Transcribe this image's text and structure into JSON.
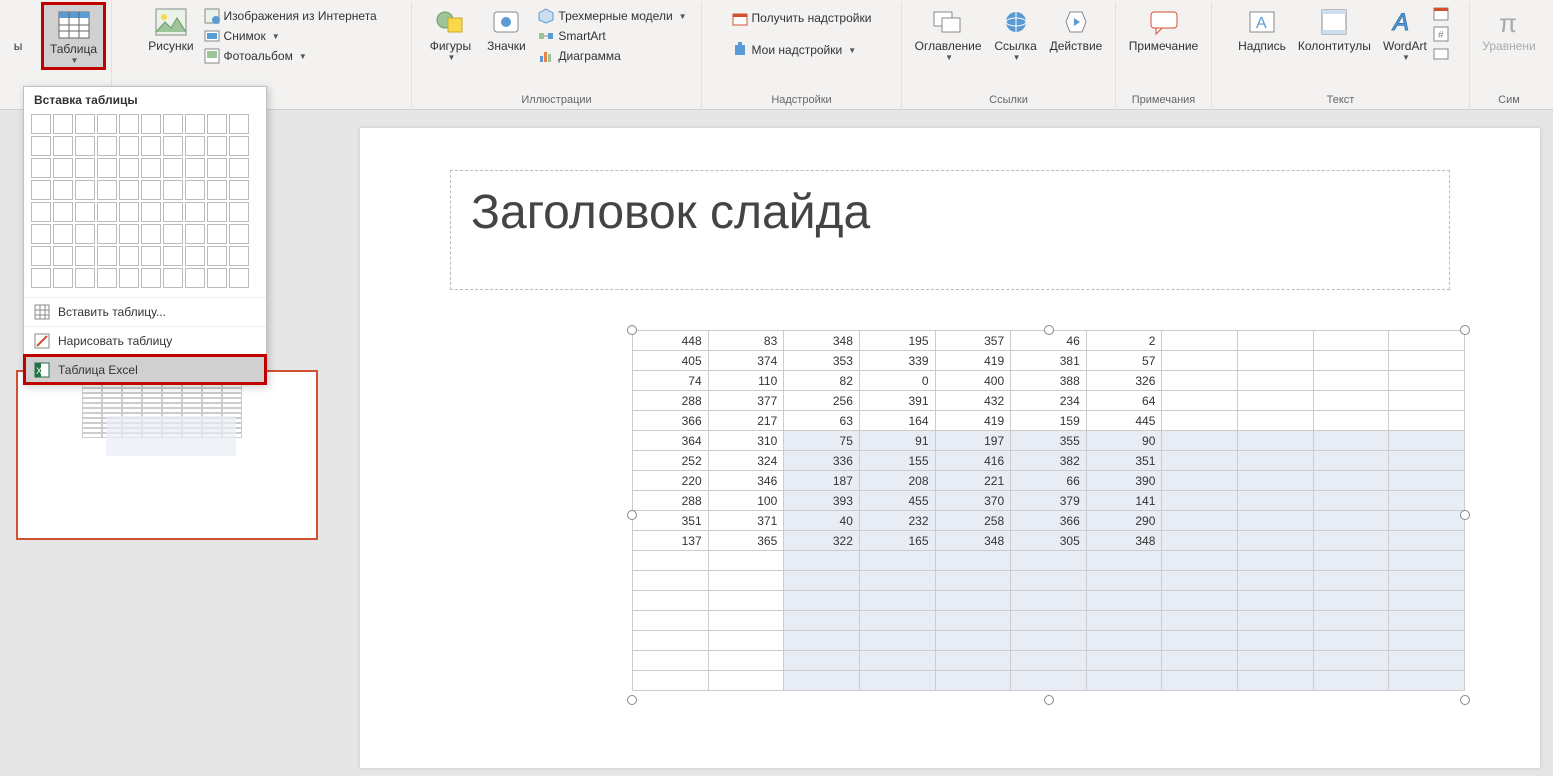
{
  "ribbon": {
    "table_btn": "Таблица",
    "pictures_btn": "Рисунки",
    "online_pics": "Изображения из Интернета",
    "screenshot": "Снимок",
    "photo_album": "Фотоальбом",
    "shapes": "Фигуры",
    "icons": "Значки",
    "models3d": "Трехмерные модели",
    "smartart": "SmartArt",
    "chart": "Диаграмма",
    "get_addins": "Получить надстройки",
    "my_addins": "Мои надстройки",
    "zoom": "Оглавление",
    "link": "Ссылка",
    "action": "Действие",
    "comment": "Примечание",
    "textbox": "Надпись",
    "header_footer": "Колонтитулы",
    "wordart": "WordArt",
    "equation": "Уравнени",
    "group_illustrations": "Иллюстрации",
    "group_addins": "Надстройки",
    "group_links": "Ссылки",
    "group_comments": "Примечания",
    "group_text": "Текст",
    "group_symbols": "Сим",
    "leftcut": "ы"
  },
  "table_dropdown": {
    "header": "Вставка таблицы",
    "insert_table": "Вставить таблицу...",
    "draw_table": "Нарисовать таблицу",
    "excel_table": "Таблица Excel"
  },
  "slide": {
    "title": "Заголовок слайда"
  },
  "excel": {
    "rows": [
      [
        448,
        83,
        348,
        195,
        357,
        46,
        2
      ],
      [
        405,
        374,
        353,
        339,
        419,
        381,
        57
      ],
      [
        74,
        110,
        82,
        0,
        400,
        388,
        326
      ],
      [
        288,
        377,
        256,
        391,
        432,
        234,
        64
      ],
      [
        366,
        217,
        63,
        164,
        419,
        159,
        445
      ],
      [
        364,
        310,
        75,
        91,
        197,
        355,
        90
      ],
      [
        252,
        324,
        336,
        155,
        416,
        382,
        351
      ],
      [
        220,
        346,
        187,
        208,
        221,
        66,
        390
      ],
      [
        288,
        100,
        393,
        455,
        370,
        379,
        141
      ],
      [
        351,
        371,
        40,
        232,
        258,
        366,
        290
      ],
      [
        137,
        365,
        322,
        165,
        348,
        305,
        348
      ]
    ],
    "sel_start_row": 5,
    "sel_start_col": 2,
    "total_cols": 11,
    "blank_rows": 7
  }
}
